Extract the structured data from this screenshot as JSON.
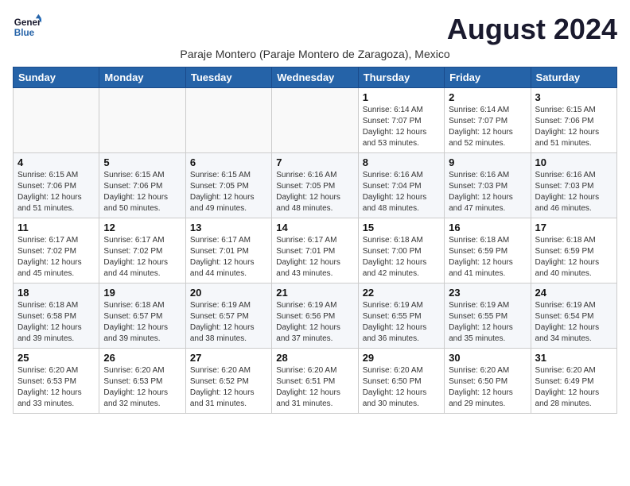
{
  "header": {
    "logo_line1": "General",
    "logo_line2": "Blue",
    "month_title": "August 2024",
    "subtitle": "Paraje Montero (Paraje Montero de Zaragoza), Mexico"
  },
  "days_of_week": [
    "Sunday",
    "Monday",
    "Tuesday",
    "Wednesday",
    "Thursday",
    "Friday",
    "Saturday"
  ],
  "weeks": [
    [
      {
        "day": "",
        "info": ""
      },
      {
        "day": "",
        "info": ""
      },
      {
        "day": "",
        "info": ""
      },
      {
        "day": "",
        "info": ""
      },
      {
        "day": "1",
        "info": "Sunrise: 6:14 AM\nSunset: 7:07 PM\nDaylight: 12 hours\nand 53 minutes."
      },
      {
        "day": "2",
        "info": "Sunrise: 6:14 AM\nSunset: 7:07 PM\nDaylight: 12 hours\nand 52 minutes."
      },
      {
        "day": "3",
        "info": "Sunrise: 6:15 AM\nSunset: 7:06 PM\nDaylight: 12 hours\nand 51 minutes."
      }
    ],
    [
      {
        "day": "4",
        "info": "Sunrise: 6:15 AM\nSunset: 7:06 PM\nDaylight: 12 hours\nand 51 minutes."
      },
      {
        "day": "5",
        "info": "Sunrise: 6:15 AM\nSunset: 7:06 PM\nDaylight: 12 hours\nand 50 minutes."
      },
      {
        "day": "6",
        "info": "Sunrise: 6:15 AM\nSunset: 7:05 PM\nDaylight: 12 hours\nand 49 minutes."
      },
      {
        "day": "7",
        "info": "Sunrise: 6:16 AM\nSunset: 7:05 PM\nDaylight: 12 hours\nand 48 minutes."
      },
      {
        "day": "8",
        "info": "Sunrise: 6:16 AM\nSunset: 7:04 PM\nDaylight: 12 hours\nand 48 minutes."
      },
      {
        "day": "9",
        "info": "Sunrise: 6:16 AM\nSunset: 7:03 PM\nDaylight: 12 hours\nand 47 minutes."
      },
      {
        "day": "10",
        "info": "Sunrise: 6:16 AM\nSunset: 7:03 PM\nDaylight: 12 hours\nand 46 minutes."
      }
    ],
    [
      {
        "day": "11",
        "info": "Sunrise: 6:17 AM\nSunset: 7:02 PM\nDaylight: 12 hours\nand 45 minutes."
      },
      {
        "day": "12",
        "info": "Sunrise: 6:17 AM\nSunset: 7:02 PM\nDaylight: 12 hours\nand 44 minutes."
      },
      {
        "day": "13",
        "info": "Sunrise: 6:17 AM\nSunset: 7:01 PM\nDaylight: 12 hours\nand 44 minutes."
      },
      {
        "day": "14",
        "info": "Sunrise: 6:17 AM\nSunset: 7:01 PM\nDaylight: 12 hours\nand 43 minutes."
      },
      {
        "day": "15",
        "info": "Sunrise: 6:18 AM\nSunset: 7:00 PM\nDaylight: 12 hours\nand 42 minutes."
      },
      {
        "day": "16",
        "info": "Sunrise: 6:18 AM\nSunset: 6:59 PM\nDaylight: 12 hours\nand 41 minutes."
      },
      {
        "day": "17",
        "info": "Sunrise: 6:18 AM\nSunset: 6:59 PM\nDaylight: 12 hours\nand 40 minutes."
      }
    ],
    [
      {
        "day": "18",
        "info": "Sunrise: 6:18 AM\nSunset: 6:58 PM\nDaylight: 12 hours\nand 39 minutes."
      },
      {
        "day": "19",
        "info": "Sunrise: 6:18 AM\nSunset: 6:57 PM\nDaylight: 12 hours\nand 39 minutes."
      },
      {
        "day": "20",
        "info": "Sunrise: 6:19 AM\nSunset: 6:57 PM\nDaylight: 12 hours\nand 38 minutes."
      },
      {
        "day": "21",
        "info": "Sunrise: 6:19 AM\nSunset: 6:56 PM\nDaylight: 12 hours\nand 37 minutes."
      },
      {
        "day": "22",
        "info": "Sunrise: 6:19 AM\nSunset: 6:55 PM\nDaylight: 12 hours\nand 36 minutes."
      },
      {
        "day": "23",
        "info": "Sunrise: 6:19 AM\nSunset: 6:55 PM\nDaylight: 12 hours\nand 35 minutes."
      },
      {
        "day": "24",
        "info": "Sunrise: 6:19 AM\nSunset: 6:54 PM\nDaylight: 12 hours\nand 34 minutes."
      }
    ],
    [
      {
        "day": "25",
        "info": "Sunrise: 6:20 AM\nSunset: 6:53 PM\nDaylight: 12 hours\nand 33 minutes."
      },
      {
        "day": "26",
        "info": "Sunrise: 6:20 AM\nSunset: 6:53 PM\nDaylight: 12 hours\nand 32 minutes."
      },
      {
        "day": "27",
        "info": "Sunrise: 6:20 AM\nSunset: 6:52 PM\nDaylight: 12 hours\nand 31 minutes."
      },
      {
        "day": "28",
        "info": "Sunrise: 6:20 AM\nSunset: 6:51 PM\nDaylight: 12 hours\nand 31 minutes."
      },
      {
        "day": "29",
        "info": "Sunrise: 6:20 AM\nSunset: 6:50 PM\nDaylight: 12 hours\nand 30 minutes."
      },
      {
        "day": "30",
        "info": "Sunrise: 6:20 AM\nSunset: 6:50 PM\nDaylight: 12 hours\nand 29 minutes."
      },
      {
        "day": "31",
        "info": "Sunrise: 6:20 AM\nSunset: 6:49 PM\nDaylight: 12 hours\nand 28 minutes."
      }
    ]
  ]
}
